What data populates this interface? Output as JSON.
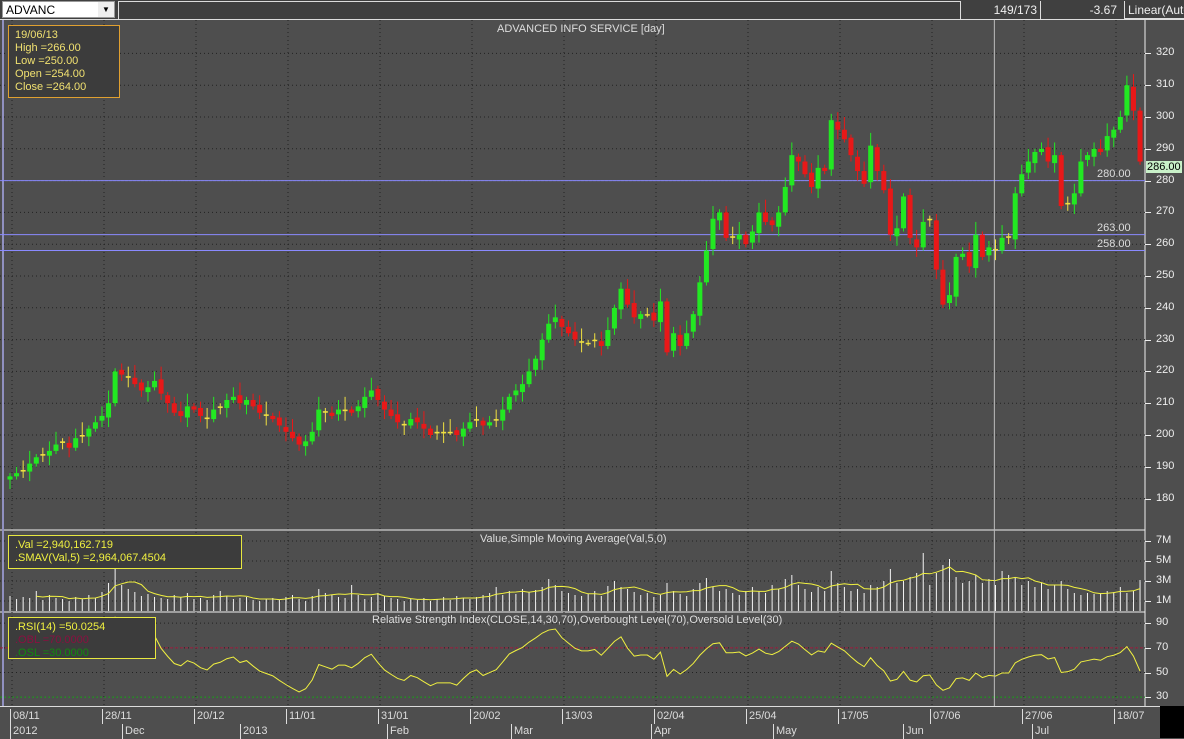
{
  "toolbar": {
    "symbol": "ADVANC",
    "position": "149/173",
    "change": "-3.67",
    "scale": "Linear(Auto"
  },
  "price_pane": {
    "title": "ADVANCED INFO SERVICE [day]",
    "readout": {
      "date": "19/06/13",
      "high": "High  =266.00",
      "low": "Low  =250.00",
      "open": "Open  =254.00",
      "close": "Close  =264.00"
    },
    "last_price": "286.00",
    "levels": [
      {
        "value": 280,
        "label": "280.00"
      },
      {
        "value": 263,
        "label": "263.00"
      },
      {
        "value": 258,
        "label": "258.00"
      }
    ],
    "yticks": [
      180,
      190,
      200,
      210,
      220,
      230,
      240,
      250,
      260,
      270,
      280,
      290,
      300,
      310,
      320
    ],
    "colors": {
      "up": "#22e822",
      "down": "#e81818",
      "doji": "#f0e040",
      "level": "#8a8aff"
    }
  },
  "volume_pane": {
    "title": "Value,Simple Moving Average(Val,5,0)",
    "val_readout": ".Val   =2,940,162.719",
    "sma_readout": ".SMAV(Val,5)   =2,964,067.4504",
    "yticks": [
      "7M",
      "5M",
      "3M",
      "1M"
    ],
    "ytick_values": [
      7,
      5,
      3,
      1
    ]
  },
  "rsi_pane": {
    "title": "Relative Strength Index(CLOSE,14,30,70),Overbought Level(70),Oversold Level(30)",
    "rsi_readout": ".RSI(14)   =50.0254",
    "obl_readout": ".OBL   =70.0000",
    "osl_readout": ".OSL   =30.0000",
    "yticks": [
      90,
      70,
      50,
      30
    ],
    "overbought": 70,
    "oversold": 30
  },
  "date_axis": {
    "days": [
      "08/11",
      "28/11",
      "20/12",
      "11/01",
      "31/01",
      "20/02",
      "13/03",
      "02/04",
      "25/04",
      "17/05",
      "07/06",
      "27/06",
      "18/07"
    ],
    "months": [
      "2012",
      "Dec",
      "2013",
      "Feb",
      "Mar",
      "Apr",
      "May",
      "Jun",
      "Jul"
    ]
  },
  "chart_data": {
    "type": "candlestick",
    "ylim": [
      175,
      325
    ],
    "close": [
      187,
      188,
      189,
      191,
      193,
      194,
      195,
      197,
      198,
      196,
      199,
      200,
      202,
      204,
      206,
      210,
      220,
      219,
      218,
      216,
      214,
      215,
      217,
      213,
      210,
      207,
      206,
      209,
      208,
      206,
      205,
      208,
      209,
      211,
      212,
      210,
      211,
      209,
      207,
      206,
      205,
      203,
      201,
      199,
      197,
      198,
      201,
      208,
      207,
      206,
      208,
      208,
      207,
      209,
      212,
      214,
      211,
      208,
      206,
      204,
      203,
      205,
      204,
      202,
      200,
      201,
      201,
      201,
      200,
      202,
      204,
      205,
      203,
      204,
      205,
      208,
      212,
      214,
      216,
      220,
      224,
      230,
      235,
      237,
      234,
      232,
      230,
      229,
      229,
      230,
      228,
      233,
      240,
      246,
      241,
      237,
      238,
      238,
      236,
      242,
      226,
      232,
      228,
      232,
      238,
      248,
      258,
      268,
      270,
      262,
      262,
      263,
      260,
      264,
      270,
      267,
      266,
      270,
      278,
      288,
      286,
      282,
      278,
      284,
      283,
      299,
      296,
      293,
      288,
      283,
      279,
      291,
      283,
      277,
      263,
      265,
      275,
      262,
      259,
      267,
      268,
      252,
      241,
      244,
      256,
      257,
      253,
      263,
      256,
      259,
      258,
      262,
      262,
      276,
      282,
      286,
      289,
      290,
      286,
      288,
      272,
      273,
      276,
      286,
      288,
      290,
      289,
      294,
      296,
      300,
      310,
      302,
      286
    ],
    "volume_millions": [
      1.5,
      1.2,
      1.4,
      1.3,
      2.0,
      1.1,
      1.6,
      1.3,
      1.2,
      1.0,
      1.4,
      1.2,
      1.6,
      1.3,
      1.9,
      2.8,
      5.0,
      2.6,
      2.2,
      1.9,
      1.5,
      1.7,
      1.4,
      1.3,
      1.2,
      1.6,
      1.4,
      1.8,
      1.2,
      1.3,
      1.1,
      1.6,
      2.0,
      1.5,
      1.2,
      1.3,
      1.4,
      1.1,
      1.0,
      1.2,
      1.3,
      1.1,
      1.4,
      1.6,
      1.2,
      1.0,
      1.5,
      2.2,
      1.8,
      1.6,
      1.4,
      1.3,
      2.6,
      1.6,
      1.2,
      1.4,
      1.8,
      1.5,
      1.3,
      1.2,
      1.0,
      1.2,
      1.1,
      1.3,
      1.0,
      1.2,
      1.4,
      1.1,
      1.5,
      1.3,
      1.2,
      1.4,
      1.6,
      1.8,
      2.4,
      1.6,
      2.0,
      1.7,
      2.2,
      1.9,
      2.1,
      2.4,
      3.2,
      2.6,
      2.0,
      1.8,
      1.6,
      1.5,
      1.7,
      2.0,
      1.5,
      2.5,
      3.0,
      2.4,
      2.2,
      1.9,
      1.6,
      1.8,
      1.4,
      1.6,
      2.8,
      2.0,
      1.7,
      1.5,
      2.2,
      2.8,
      3.3,
      2.4,
      2.0,
      2.2,
      1.8,
      1.6,
      2.0,
      2.4,
      2.0,
      1.8,
      2.6,
      2.2,
      3.2,
      3.6,
      2.6,
      2.2,
      1.9,
      2.4,
      2.0,
      4.0,
      2.8,
      2.4,
      2.0,
      2.2,
      1.8,
      2.6,
      2.4,
      3.0,
      4.2,
      2.8,
      3.0,
      3.4,
      3.8,
      5.8,
      2.6,
      3.8,
      4.6,
      5.2,
      3.4,
      2.8,
      3.0,
      3.6,
      2.8,
      3.2,
      2.6,
      4.0,
      3.6,
      3.4,
      2.6,
      3.0,
      2.4,
      2.8,
      2.2,
      2.6,
      3.0,
      2.2,
      1.8,
      1.6,
      1.8,
      1.7,
      1.8,
      2.0,
      1.9,
      2.4,
      1.8,
      2.0,
      3.1
    ],
    "cursor_index": 148
  }
}
